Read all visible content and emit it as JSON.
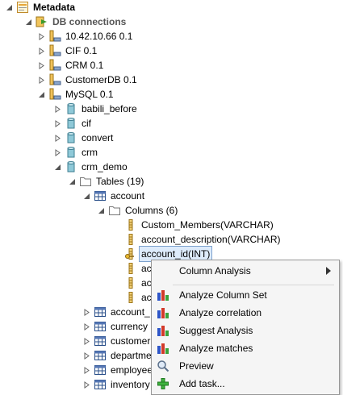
{
  "tree": {
    "root": "Metadata",
    "db_connections": "DB connections",
    "connections": [
      "10.42.10.66 0.1",
      "CIF 0.1",
      "CRM 0.1",
      "CustomerDB 0.1",
      "MySQL 0.1"
    ],
    "schemas": [
      "babili_before",
      "cif",
      "convert",
      "crm",
      "crm_demo"
    ],
    "tables_folder": "Tables (19)",
    "table_account": "account",
    "columns_folder": "Columns (6)",
    "columns": [
      "Custom_Members(VARCHAR)",
      "account_description(VARCHAR)",
      "account_id(INT)",
      "ac",
      "ac",
      "ac"
    ],
    "other_tables": [
      "account_",
      "currency",
      "customer",
      "departme",
      "employee",
      "inventory"
    ]
  },
  "context_menu": {
    "items": [
      {
        "label": "Column Analysis",
        "icon": "none",
        "submenu": true
      },
      {
        "label": "Analyze Column Set",
        "icon": "analysis-icon"
      },
      {
        "label": "Analyze correlation",
        "icon": "analysis-icon"
      },
      {
        "label": "Suggest Analysis",
        "icon": "analysis-icon"
      },
      {
        "label": "Analyze matches",
        "icon": "analysis-icon"
      },
      {
        "label": "Preview",
        "icon": "magnifier-icon"
      },
      {
        "label": "Add task...",
        "icon": "plus-icon"
      }
    ]
  }
}
